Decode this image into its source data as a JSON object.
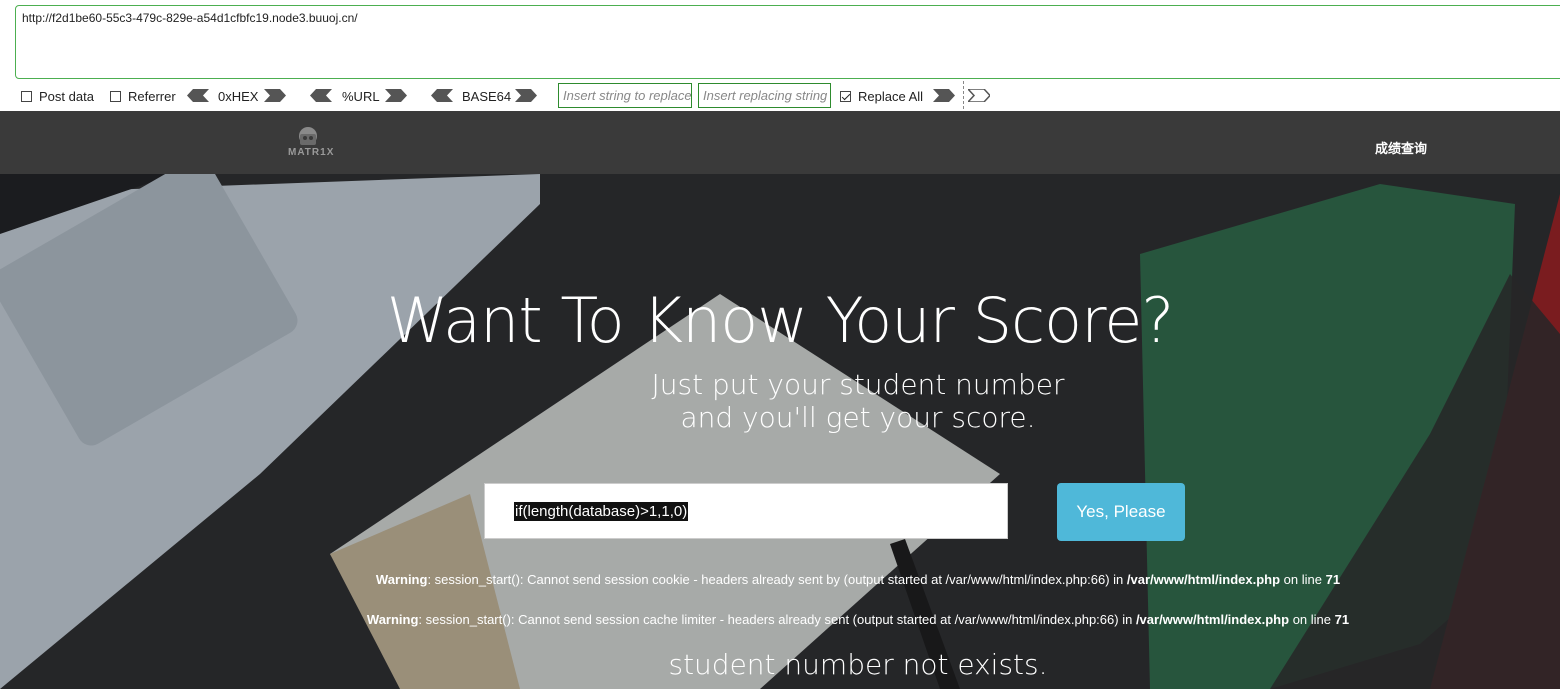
{
  "hackbar": {
    "url": "http://f2d1be60-55c3-479c-829e-a54d1cfbfc19.node3.buuoj.cn/",
    "post_data_label": "Post data",
    "referrer_label": "Referrer",
    "hex_label": "0xHEX",
    "url_label": "%URL",
    "base64_label": "BASE64",
    "replace_placeholder": "Insert string to replace",
    "replacing_placeholder": "Insert replacing string",
    "replace_all_label": "Replace All",
    "post_data_checked": false,
    "referrer_checked": false,
    "replace_all_checked": true
  },
  "navbar": {
    "logo_text": "MATR1X",
    "link": "成绩查询"
  },
  "hero": {
    "title": "Want To Know Your Score?",
    "subtitle_line1": "Just put your student number",
    "subtitle_line2": "and you'll get your score.",
    "input_value": "if(length(database)>1,1,0)",
    "button_label": "Yes, Please"
  },
  "warnings": [
    {
      "label": "Warning",
      "text_before": ": session_start(): Cannot send session cookie - headers already sent by (output started at /var/www/html/index.php:66) in ",
      "path": "/var/www/html/index.php",
      "text_mid": " on line ",
      "line": "71"
    },
    {
      "label": "Warning",
      "text_before": ": session_start(): Cannot send session cache limiter - headers already sent (output started at /var/www/html/index.php:66) in ",
      "path": "/var/www/html/index.php",
      "text_mid": " on line ",
      "line": "71"
    }
  ],
  "result_text": "student number not exists.",
  "colors": {
    "accent_green": "#4caf50",
    "nav_bg": "#3a3a3a",
    "button_bg": "#4fb8d9"
  }
}
